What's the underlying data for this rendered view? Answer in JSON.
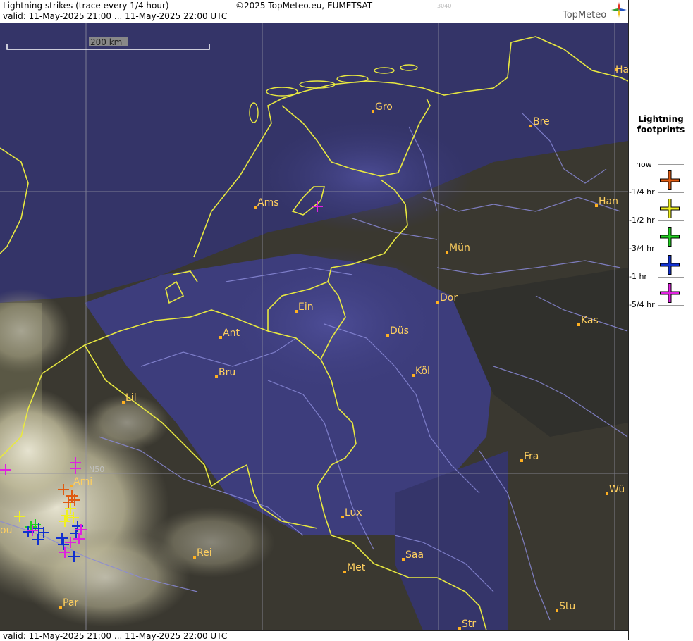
{
  "header": {
    "title": "Lightning strikes (trace every 1/4 hour)",
    "copyright": "©2025 TopMeteo.eu, EUMETSAT",
    "code": "3040",
    "valid": "valid:  11-May-2025 21:00 ... 11-May-2025 22:00 UTC"
  },
  "logo": {
    "text": "TopMeteo"
  },
  "footer": {
    "valid": "valid:  11-May-2025 21:00 ... 11-May-2025 22:00 UTC"
  },
  "scale": {
    "label": "200 km"
  },
  "gridlabel": "N50",
  "cities": [
    "Ha",
    "Gro",
    "Bre",
    "Ams",
    "Han",
    "Mün",
    "Dor",
    "Ein",
    "Ant",
    "Düs",
    "Kas",
    "Bru",
    "Köl",
    "Lil",
    "Fra",
    "Ami",
    "Wü",
    "ou",
    "Lux",
    "Rei",
    "Saa",
    "Met",
    "Par",
    "Stu",
    "Str"
  ],
  "legend": {
    "title_line1": "Lightning",
    "title_line2": "footprints",
    "items": [
      {
        "label": "now",
        "color": ""
      },
      {
        "label": "-1/4 hr",
        "color": "#e05a10"
      },
      {
        "label": "-1/2 hr",
        "color": "#f0f020"
      },
      {
        "label": "-3/4 hr",
        "color": "#20d020"
      },
      {
        "label": "-1 hr",
        "color": "#1030d0"
      },
      {
        "label": "-5/4 hr",
        "color": "#e020e0"
      }
    ]
  },
  "strike_colors": {
    "quarter": "#e05a10",
    "half": "#f0f020",
    "threequarter": "#20d020",
    "hour": "#1030d0",
    "fivequarter": "#e020e0"
  }
}
